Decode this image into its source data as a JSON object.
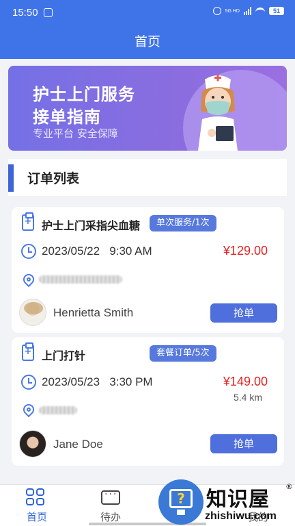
{
  "status_bar": {
    "time": "15:50",
    "network": "5G HD",
    "battery": "51"
  },
  "header": {
    "title": "首页"
  },
  "banner": {
    "title_line_1": "护士上门服务",
    "title_line_2": "接单指南",
    "subtitle": "专业平台  安全保障"
  },
  "section": {
    "title": "订单列表"
  },
  "orders": [
    {
      "service": "护士上门采指尖血糖",
      "badge": "单次服务/1次",
      "date": "2023/05/22",
      "time": "9:30 AM",
      "price": "¥129.00",
      "distance": "",
      "customer": "Henrietta Smith",
      "action": "抢单"
    },
    {
      "service": "上门打针",
      "badge": "套餐订单/5次",
      "date": "2023/05/23",
      "time": "3:30 PM",
      "price": "¥149.00",
      "distance": "5.4 km",
      "customer": "Jane Doe",
      "action": "抢单"
    }
  ],
  "tabbar": {
    "tabs": [
      {
        "label": "首页",
        "icon": "home-grid-icon",
        "active": true
      },
      {
        "label": "待办",
        "icon": "chat-todo-icon",
        "active": false
      },
      {
        "label": "",
        "icon": "",
        "active": false
      },
      {
        "label": "我的",
        "icon": "profile-icon",
        "active": false
      }
    ]
  },
  "watermark": {
    "logo": "知识屋",
    "registered": "®",
    "url": "zhishiwu.com"
  },
  "colors": {
    "primary": "#3f73e8",
    "button": "#4f6fdc",
    "price": "#e52222",
    "background": "#f2f3f7"
  }
}
